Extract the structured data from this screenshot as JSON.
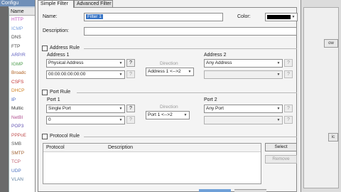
{
  "background": {
    "tab_label": "Configu",
    "list_header": "Name",
    "protocols": [
      {
        "label": "HTTP",
        "color": "#c050c0"
      },
      {
        "label": "ICMP",
        "color": "#7aa0e0"
      },
      {
        "label": "DNS",
        "color": "#444444"
      },
      {
        "label": "FTP",
        "color": "#444444"
      },
      {
        "label": "ARP/R",
        "color": "#6060c0"
      },
      {
        "label": "IGMP",
        "color": "#4b9b4b"
      },
      {
        "label": "Broadc",
        "color": "#b06020"
      },
      {
        "label": "CSFS",
        "color": "#c03030"
      },
      {
        "label": "DHCP",
        "color": "#d08020"
      },
      {
        "label": "IP",
        "color": "#4060c0"
      },
      {
        "label": "Multic",
        "color": "#333333"
      },
      {
        "label": "NetBI",
        "color": "#b05090"
      },
      {
        "label": "POP3",
        "color": "#6050b0"
      },
      {
        "label": "PPPoE",
        "color": "#c05050"
      },
      {
        "label": "SMB",
        "color": "#555555"
      },
      {
        "label": "SMTP",
        "color": "#a06030"
      },
      {
        "label": "TCP",
        "color": "#c06070"
      },
      {
        "label": "UDP",
        "color": "#4a70c0"
      },
      {
        "label": "VLAN",
        "color": "#6080a0"
      }
    ],
    "right_buttons": [
      "ow",
      "ic"
    ]
  },
  "tabs": [
    {
      "label": "Simple Filter",
      "active": true
    },
    {
      "label": "Advanced Filter",
      "active": false
    }
  ],
  "form": {
    "name_label": "Name:",
    "name_value": "Filter 1",
    "color_label": "Color:",
    "color_value": "#000000",
    "description_label": "Description:",
    "description_value": ""
  },
  "address_rule": {
    "checkbox_label": "Address Rule",
    "address1_label": "Address 1",
    "address1_type": "Physical Address",
    "address1_value": "00:00:00:00:00:00",
    "direction_label": "Direction",
    "direction_value": "Address 1 <-->2",
    "address2_label": "Address 2",
    "address2_type": "Any Address",
    "address2_value": ""
  },
  "port_rule": {
    "checkbox_label": "Port Rule",
    "port1_label": "Port 1",
    "port1_type": "Single Port",
    "port1_value": "0",
    "direction_label": "Direction",
    "direction_value": "Port 1 <-->2",
    "port2_label": "Port 2",
    "port2_type": "Any Port",
    "port2_value": ""
  },
  "protocol_rule": {
    "checkbox_label": "Protocol Rule",
    "columns": [
      "Protocol",
      "Description"
    ],
    "select_button": "Select",
    "remove_button": "Remove"
  },
  "buttons": {
    "question": "?"
  }
}
